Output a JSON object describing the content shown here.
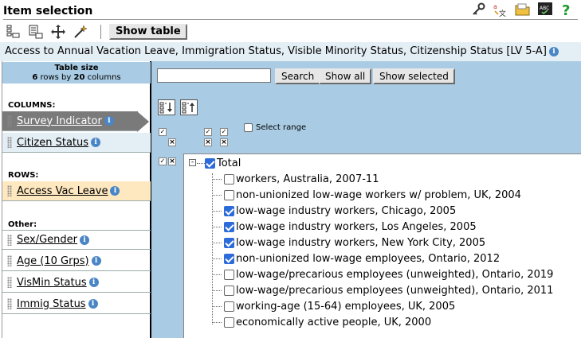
{
  "header": {
    "title": "Item selection",
    "icons": [
      "key-icon",
      "language-icon",
      "folder-icon",
      "spellcheck-icon",
      "help-icon"
    ]
  },
  "toolbar": {
    "icons": [
      "layout-icon",
      "layout-edit-icon",
      "move-icon",
      "wand-icon"
    ],
    "show_table_label": "Show table"
  },
  "subtitle": "Access to Annual Vacation Leave, Immigration Status, Visible Minority Status, Citizenship Status [LV 5-A]",
  "table_size": {
    "label": "Table size",
    "rows": "6",
    "rows_word": "rows by",
    "columns": "20",
    "columns_word": "columns"
  },
  "sections": {
    "columns": "COLUMNS:",
    "rows": "ROWS:",
    "other": "Other:"
  },
  "dimensions": {
    "columns": [
      "Survey Indicator",
      "Citizen Status"
    ],
    "rows": [
      "Access Vac Leave"
    ],
    "other": [
      "Sex/Gender",
      "Age (10 Grps)",
      "VisMin Status",
      "Immig Status"
    ]
  },
  "search": {
    "value": "",
    "search_label": "Search",
    "show_all_label": "Show all",
    "show_selected_label": "Show selected"
  },
  "select_range_label": "Select range",
  "tree": {
    "root_label": "Total",
    "root_checked": true,
    "items": [
      {
        "label": "workers, Australia, 2007-11",
        "checked": false
      },
      {
        "label": "non-unionized low-wage workers w/ problem, UK, 2004",
        "checked": false
      },
      {
        "label": "low-wage industry workers, Chicago, 2005",
        "checked": true
      },
      {
        "label": "low-wage industry workers, Los Angeles, 2005",
        "checked": true
      },
      {
        "label": "low-wage industry workers, New York City, 2005",
        "checked": true
      },
      {
        "label": "non-unionized low-wage employees, Ontario, 2012",
        "checked": true
      },
      {
        "label": "low-wage/precarious employees (unweighted), Ontario, 2019",
        "checked": false
      },
      {
        "label": "low-wage/precarious employees (unweighted), Ontario, 2011",
        "checked": false
      },
      {
        "label": "working-age (15-64) employees, UK, 2005",
        "checked": false
      },
      {
        "label": "economically active people, UK, 2000",
        "checked": false
      }
    ]
  },
  "colors": {
    "panel_blue": "#a9cbe3",
    "subtitle_bg": "#e4eef5",
    "selected_dim": "#7a7a7a",
    "row_dim": "#fde8c0",
    "checkbox_blue": "#2c6bd9",
    "info_blue": "#4a86c5"
  }
}
